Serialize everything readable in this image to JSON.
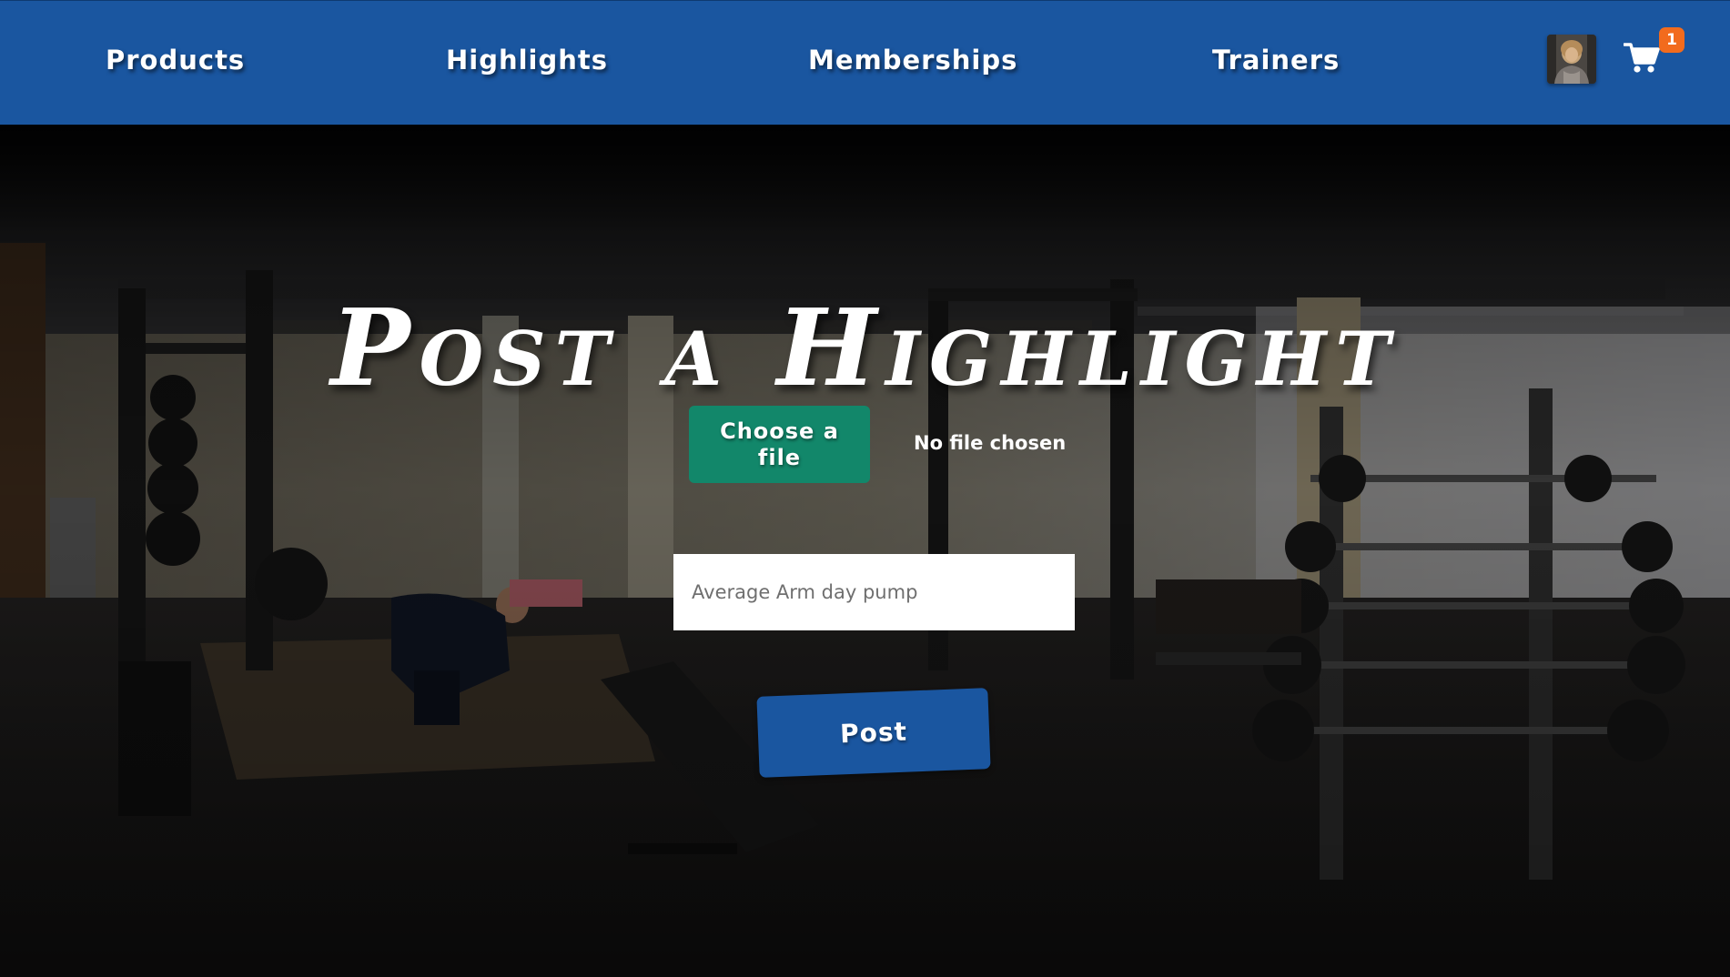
{
  "nav": {
    "items": [
      {
        "label": "Products"
      },
      {
        "label": "Highlights"
      },
      {
        "label": "Memberships"
      },
      {
        "label": "Trainers"
      }
    ],
    "cart_count": "1",
    "cart_icon": "shopping-cart-icon",
    "avatar_icon": "user-avatar"
  },
  "page": {
    "title": "Post a Highlight"
  },
  "upload": {
    "choose_file_label": "Choose a file",
    "file_status": "No file chosen"
  },
  "caption": {
    "placeholder": "Average Arm day pump",
    "value": ""
  },
  "post": {
    "label": "Post"
  },
  "colors": {
    "nav_background": "#1a56a0",
    "choose_file_button": "#12876a",
    "post_button": "#1a56a0",
    "cart_badge": "#f26b1d"
  }
}
